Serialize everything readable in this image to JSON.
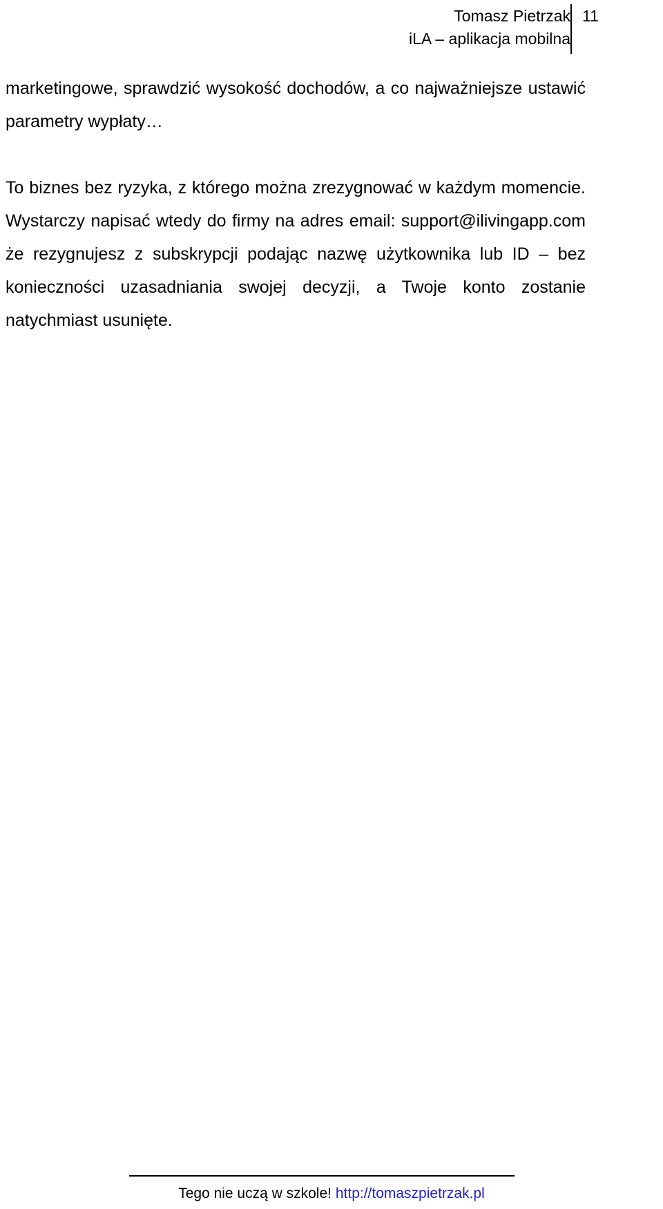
{
  "header": {
    "author": "Tomasz Pietrzak",
    "book_title": "iLA – aplikacja mobilna",
    "page_number": "11"
  },
  "content": {
    "paragraph_1": "marketingowe, sprawdzić wysokość dochodów, a co najważniejsze ustawić parametry wypłaty…",
    "paragraph_2": "To biznes bez ryzyka, z którego można zrezygnować w każdym momencie. Wystarczy napisać wtedy do firmy na adres email: support@ilivingapp.com że rezygnujesz z subskrypcji podając nazwę użytkownika lub ID – bez konieczności uzasadniania swojej decyzji, a Twoje konto zostanie natychmiast usunięte."
  },
  "footer": {
    "tagline": "Tego nie uczą w szkole!",
    "link_text": "http://tomaszpietrzak.pl",
    "link_color": "#2121d6"
  }
}
